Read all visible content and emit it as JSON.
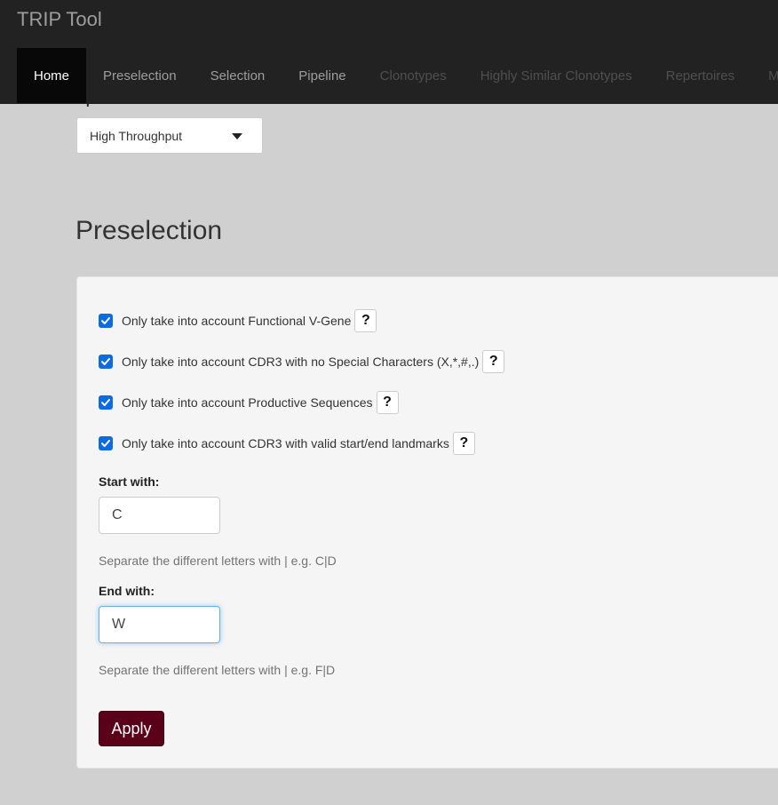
{
  "app": {
    "title": "TRIP Tool"
  },
  "nav": {
    "tabs": [
      {
        "label": "Home",
        "state": "active"
      },
      {
        "label": "Preselection",
        "state": "normal"
      },
      {
        "label": "Selection",
        "state": "normal"
      },
      {
        "label": "Pipeline",
        "state": "normal"
      },
      {
        "label": "Clonotypes",
        "state": "disabled"
      },
      {
        "label": "Highly Similar Clonotypes",
        "state": "disabled"
      },
      {
        "label": "Repertoires",
        "state": "disabled"
      },
      {
        "label": "Multi",
        "state": "disabled"
      }
    ]
  },
  "option": {
    "label": "Option:",
    "selected": "High Throughput"
  },
  "preselection": {
    "title": "Preselection",
    "checks": [
      {
        "label": "Only take into account Functional V-Gene",
        "checked": true
      },
      {
        "label": "Only take into account CDR3 with no Special Characters (X,*,#,.)",
        "checked": true
      },
      {
        "label": "Only take into account Productive Sequences",
        "checked": true
      },
      {
        "label": "Only take into account CDR3 with valid start/end landmarks",
        "checked": true
      }
    ],
    "help_label": "?",
    "start": {
      "label": "Start with:",
      "value": "C",
      "help": "Separate the different letters with | e.g. C|D"
    },
    "end": {
      "label": "End with:",
      "value": "W",
      "help": "Separate the different letters with | e.g. F|D"
    },
    "apply_label": "Apply"
  },
  "colors": {
    "navbar_bg": "#222222",
    "active_tab_bg": "#080808",
    "checkbox": "#0b6bdf",
    "apply_button": "#5b0019",
    "page_bg": "#d0d0d0",
    "panel_bg": "#f5f5f5"
  }
}
